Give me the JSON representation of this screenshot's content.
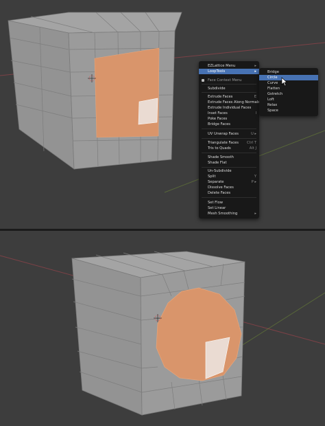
{
  "context_menu": {
    "items": [
      {
        "label": "EZLattice Menu",
        "shortcut": "",
        "submenu": true
      },
      {
        "label": "LoopTools",
        "shortcut": "",
        "submenu": true,
        "active": true
      },
      {
        "label": "Face Context Menu",
        "shortcut": "",
        "header": true
      },
      {
        "label": "Subdivide",
        "shortcut": ""
      },
      {
        "label": "Extrude Faces",
        "shortcut": "E"
      },
      {
        "label": "Extrude Faces Along Normals",
        "shortcut": ""
      },
      {
        "label": "Extrude Individual Faces",
        "shortcut": ""
      },
      {
        "label": "Inset Faces",
        "shortcut": "I"
      },
      {
        "label": "Poke Faces",
        "shortcut": ""
      },
      {
        "label": "Bridge Faces",
        "shortcut": ""
      },
      {
        "label": "UV Unwrap Faces",
        "shortcut": "U ▸"
      },
      {
        "label": "Triangulate Faces",
        "shortcut": "Ctrl T"
      },
      {
        "label": "Tris to Quads",
        "shortcut": "Alt J"
      },
      {
        "label": "Shade Smooth",
        "shortcut": ""
      },
      {
        "label": "Shade Flat",
        "shortcut": ""
      },
      {
        "label": "Un-Subdivide",
        "shortcut": ""
      },
      {
        "label": "Split",
        "shortcut": "Y"
      },
      {
        "label": "Separate",
        "shortcut": "P ▸"
      },
      {
        "label": "Dissolve Faces",
        "shortcut": ""
      },
      {
        "label": "Delete Faces",
        "shortcut": ""
      },
      {
        "label": "Set Flow",
        "shortcut": ""
      },
      {
        "label": "Set Linear",
        "shortcut": ""
      },
      {
        "label": "Mesh Smoothing",
        "shortcut": "",
        "submenu": true
      }
    ]
  },
  "looptools_submenu": {
    "items": [
      {
        "label": "Bridge"
      },
      {
        "label": "Circle",
        "active": true
      },
      {
        "label": "Curve"
      },
      {
        "label": "Flatten"
      },
      {
        "label": "Gstretch"
      },
      {
        "label": "Loft"
      },
      {
        "label": "Relax"
      },
      {
        "label": "Space"
      }
    ]
  },
  "colors": {
    "viewport_bg": "#3d3d3d",
    "mesh_face": "#9a9a9a",
    "selected_face": "#d9956b",
    "active_face": "#eadbd2",
    "menu_bg": "#181818",
    "menu_highlight": "#4772b3",
    "x_axis": "#b0454f",
    "y_axis": "#7a9b35"
  },
  "icons": [
    "3d-cursor-icon",
    "mouse-cursor-icon",
    "submenu-arrow-icon"
  ]
}
